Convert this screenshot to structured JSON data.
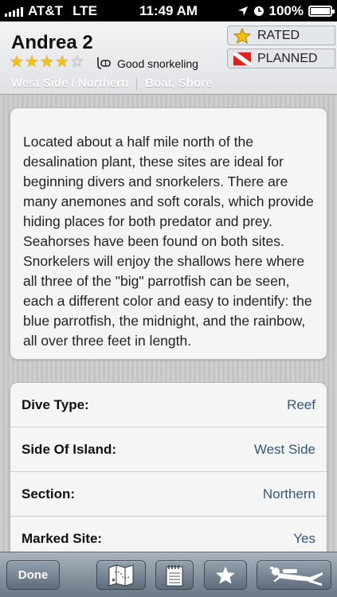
{
  "status_bar": {
    "carrier": "AT&T",
    "network": "LTE",
    "time": "11:49 AM",
    "battery": "100%"
  },
  "site": {
    "title": "Andrea 2",
    "rating": 4,
    "rating_max": 5,
    "activity": "Good snorkeling",
    "region": "West Side / Northern",
    "access": "Boat, Shore",
    "rated_label": "RATED",
    "planned_label": "PLANNED"
  },
  "description": "Located about a half mile north of the desalination plant, these sites are ideal for beginning divers and snorkelers. There are many anemones and soft corals, which provide hiding places for both predator and prey. Seahorses have been found on both sites. Snorkelers will enjoy the shallows here where all three of the \"big\" parrotfish can be seen, each a different color and easy to indentify: the blue parrotfish, the midnight, and the rainbow, all over three feet in length.",
  "details": [
    {
      "label": "Dive Type:",
      "value": "Reef"
    },
    {
      "label": "Side Of Island:",
      "value": "West Side"
    },
    {
      "label": "Section:",
      "value": "Northern"
    },
    {
      "label": "Marked Site:",
      "value": "Yes"
    }
  ],
  "toolbar": {
    "done_label": "Done",
    "buttons": [
      "map-icon",
      "notes-icon",
      "star-icon",
      "diver-icon"
    ]
  },
  "colors": {
    "detail_value": "#36567f",
    "star": "#f2c20a",
    "dive_flag": "#e0201b"
  }
}
